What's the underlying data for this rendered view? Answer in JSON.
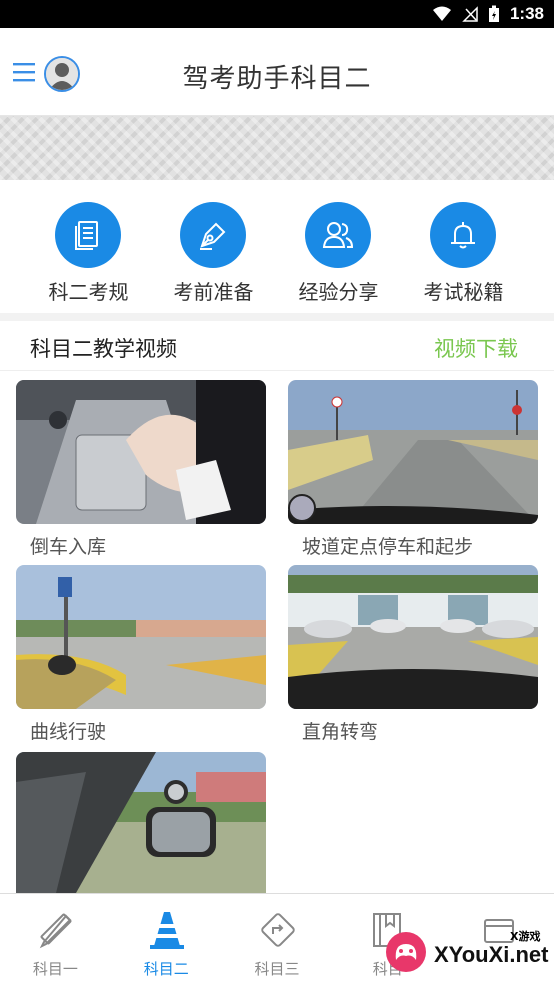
{
  "status_bar": {
    "time": "1:38"
  },
  "header": {
    "title": "驾考助手科目二"
  },
  "quick_nav": [
    {
      "label": "科二考规",
      "icon": "document-icon"
    },
    {
      "label": "考前准备",
      "icon": "pen-nib-icon"
    },
    {
      "label": "经验分享",
      "icon": "users-icon"
    },
    {
      "label": "考试秘籍",
      "icon": "bell-icon"
    }
  ],
  "videos": {
    "title": "科目二教学视频",
    "download_label": "视频下载",
    "items": [
      {
        "title": "倒车入库"
      },
      {
        "title": "坡道定点停车和起步"
      },
      {
        "title": "曲线行驶"
      },
      {
        "title": "直角转弯"
      },
      {
        "title": ""
      }
    ]
  },
  "tabs": [
    {
      "label": "科目一",
      "icon": "pencil-ruler-icon"
    },
    {
      "label": "科目二",
      "icon": "traffic-cone-icon",
      "active": true
    },
    {
      "label": "科目三",
      "icon": "road-sign-icon"
    },
    {
      "label": "科目",
      "icon": "book-icon"
    },
    {
      "label": "",
      "icon": "card-icon"
    }
  ],
  "watermark": {
    "brand": "XYouXi.net",
    "tag": "X游戏"
  },
  "colors": {
    "accent": "#1a8ae5",
    "link_green": "#7ac74f",
    "status_bar": "#000000"
  }
}
